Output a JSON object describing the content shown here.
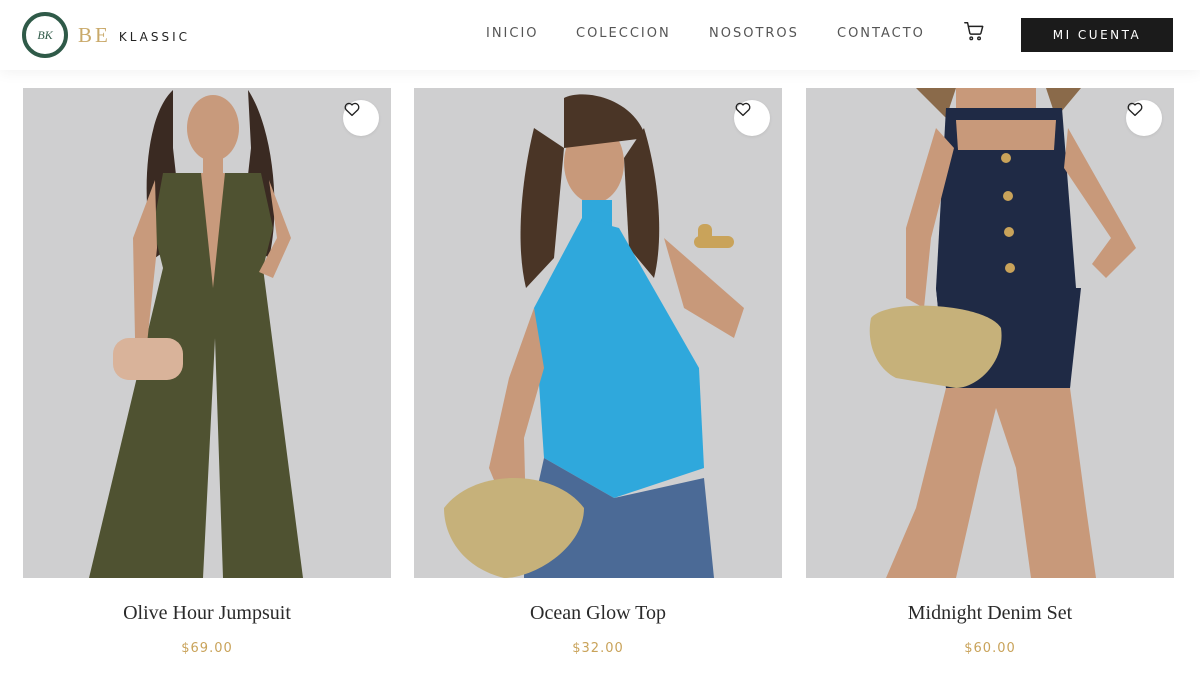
{
  "brand": {
    "monogram": "BK",
    "name_part1": "BE",
    "name_part2": "KLASSIC"
  },
  "nav": {
    "items": [
      "INICIO",
      "COLECCION",
      "NOSOTROS",
      "CONTACTO"
    ],
    "account_label": "MI CUENTA"
  },
  "products": [
    {
      "title": "Olive Hour Jumpsuit",
      "price": "$69.00",
      "garment_color": "#4f5231"
    },
    {
      "title": "Ocean Glow Top",
      "price": "$32.00",
      "garment_color": "#2fa8dc"
    },
    {
      "title": "Midnight Denim Set",
      "price": "$60.00",
      "garment_color": "#1f2a45"
    }
  ],
  "colors": {
    "accent_gold": "#c9a35a",
    "logo_green": "#2f5a48",
    "button_dark": "#1b1b1b",
    "photo_bg": "#cfcfd0"
  }
}
